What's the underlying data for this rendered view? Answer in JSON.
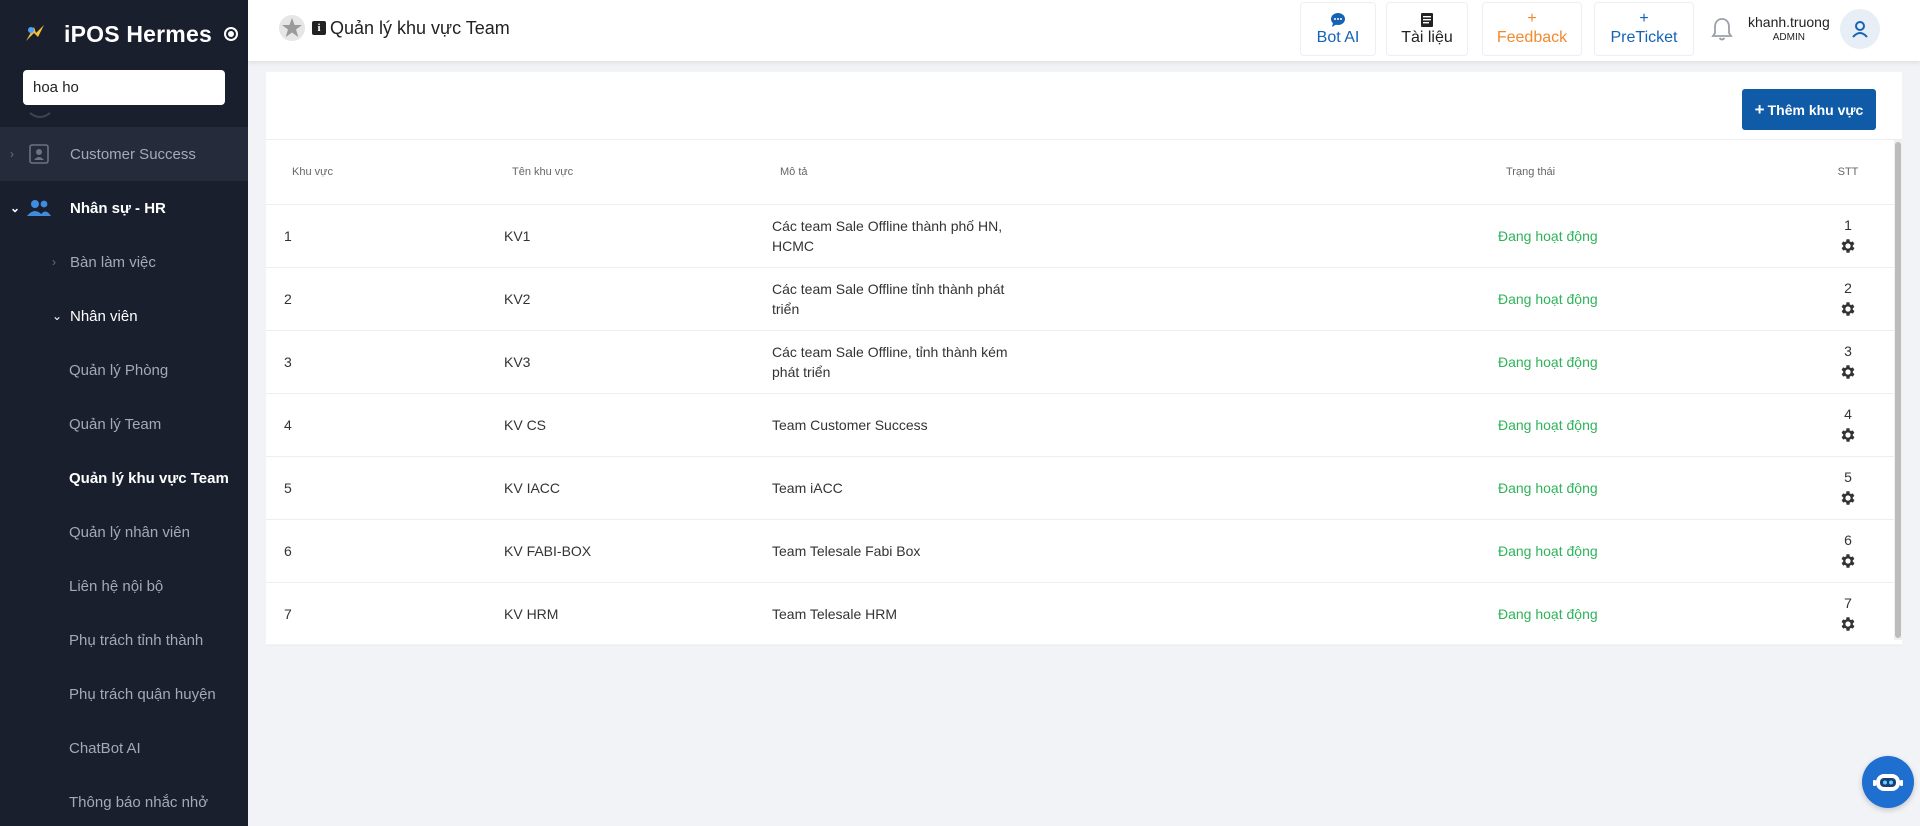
{
  "sidebar": {
    "brand": "iPOS Hermes",
    "search_value": "hoa ho",
    "items": {
      "customer_success": "Customer Success",
      "hr": "Nhân sự - HR",
      "desk": "Bàn làm việc",
      "employees": "Nhân viên",
      "room_mgmt": "Quản lý Phòng",
      "team_mgmt": "Quản lý Team",
      "team_area_mgmt": "Quản lý khu vực Team",
      "employee_mgmt": "Quản lý nhân viên",
      "internal_contact": "Liên hệ nội bộ",
      "province": "Phụ trách tỉnh thành",
      "district": "Phụ trách quận huyện",
      "chatbot": "ChatBot AI",
      "reminder": "Thông báo nhắc nhở"
    }
  },
  "header": {
    "title": "Quản lý khu vực Team",
    "bot_ai": "Bot AI",
    "docs": "Tài liệu",
    "feedback": "Feedback",
    "preticket": "PreTicket",
    "user_name": "khanh.truong",
    "user_role": "ADMIN"
  },
  "main": {
    "add_button": "Thêm khu vực",
    "columns": {
      "area": "Khu vực",
      "area_name": "Tên khu vực",
      "description": "Mô tả",
      "status": "Trạng thái",
      "order": "STT"
    },
    "rows": [
      {
        "area": "1",
        "name": "KV1",
        "desc": "Các team Sale Offline thành phố HN, HCMC",
        "status": "Đang hoạt động",
        "stt": "1"
      },
      {
        "area": "2",
        "name": "KV2",
        "desc": "Các team Sale Offline tỉnh thành phát triển",
        "status": "Đang hoạt động",
        "stt": "2"
      },
      {
        "area": "3",
        "name": "KV3",
        "desc": "Các team Sale Offline, tỉnh thành kém phát triển",
        "status": "Đang hoạt động",
        "stt": "3"
      },
      {
        "area": "4",
        "name": "KV CS",
        "desc": "Team Customer Success",
        "status": "Đang hoạt động",
        "stt": "4"
      },
      {
        "area": "5",
        "name": "KV IACC",
        "desc": "Team iACC",
        "status": "Đang hoạt động",
        "stt": "5"
      },
      {
        "area": "6",
        "name": "KV FABI-BOX",
        "desc": "Team Telesale Fabi Box",
        "status": "Đang hoạt động",
        "stt": "6"
      },
      {
        "area": "7",
        "name": "KV HRM",
        "desc": "Team Telesale HRM",
        "status": "Đang hoạt động",
        "stt": "7"
      }
    ]
  },
  "colors": {
    "sidebar_bg": "#1a1f2e",
    "accent": "#0f5ba8",
    "status_active": "#2fb35a",
    "feedback": "#f08a2c"
  }
}
